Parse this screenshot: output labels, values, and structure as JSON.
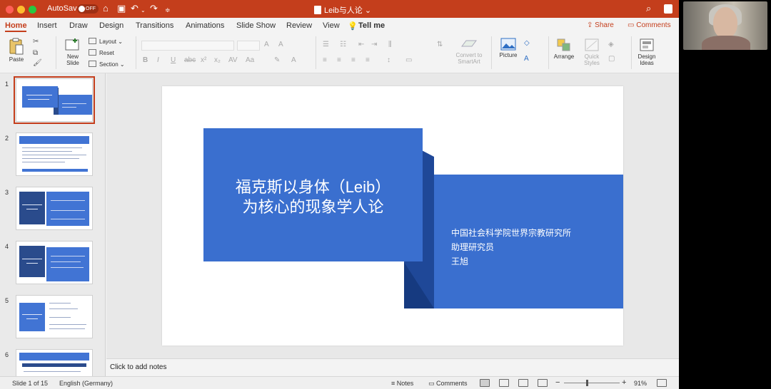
{
  "window": {
    "autosave_label": "AutoSave",
    "autosave_state": "OFF",
    "doc_title": "Leib与人论",
    "accent": "#c43e1c"
  },
  "tabs": [
    {
      "label": "Home",
      "active": true
    },
    {
      "label": "Insert"
    },
    {
      "label": "Draw"
    },
    {
      "label": "Design"
    },
    {
      "label": "Transitions"
    },
    {
      "label": "Animations"
    },
    {
      "label": "Slide Show"
    },
    {
      "label": "Review"
    },
    {
      "label": "View"
    },
    {
      "label": "Tell me"
    }
  ],
  "actions": {
    "share": "Share",
    "comments": "Comments"
  },
  "ribbon": {
    "paste": "Paste",
    "new_slide_1": "New",
    "new_slide_2": "Slide",
    "layout": "Layout",
    "reset": "Reset",
    "section": "Section",
    "convert_1": "Convert to",
    "convert_2": "SmartArt",
    "picture": "Picture",
    "arrange": "Arrange",
    "quick_1": "Quick",
    "quick_2": "Styles",
    "design_1": "Design",
    "design_2": "Ideas"
  },
  "thumbnails": [
    {
      "number": "1"
    },
    {
      "number": "2"
    },
    {
      "number": "3"
    },
    {
      "number": "4"
    },
    {
      "number": "5"
    },
    {
      "number": "6"
    }
  ],
  "slide": {
    "title_line1": "福克斯以身体（Leib）",
    "title_line2": "为核心的现象学人论",
    "subtitle_line1": "中国社会科学院世界宗教研究所",
    "subtitle_line2": "助理研究员",
    "subtitle_line3": "王旭",
    "main_color": "#3a6fcf",
    "fold_color": "#1f4898"
  },
  "notes_placeholder": "Click to add notes",
  "status": {
    "slide_position": "Slide 1 of 15",
    "language": "English (Germany)",
    "notes": "Notes",
    "comments": "Comments",
    "zoom": "91%"
  }
}
